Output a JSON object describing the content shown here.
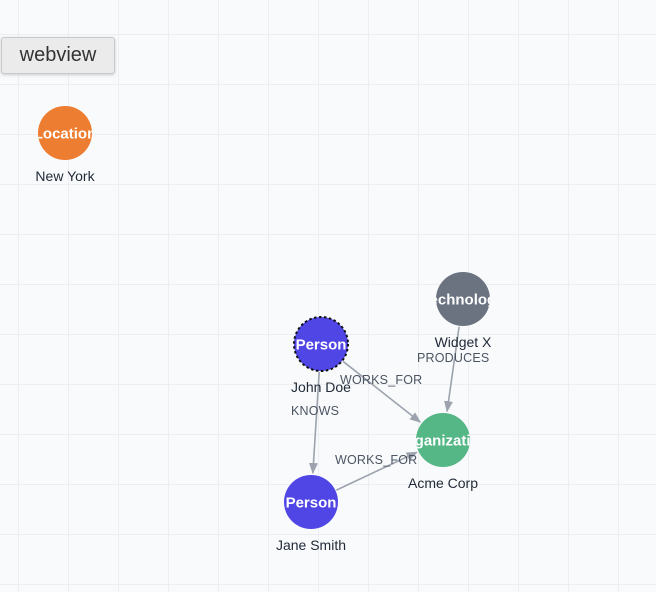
{
  "toolbar": {
    "webview_label": "webview"
  },
  "graph": {
    "nodes": [
      {
        "id": "new-york",
        "type": "Location",
        "name": "New York",
        "color": "#ed7d31"
      },
      {
        "id": "john-doe",
        "type": "Person",
        "name": "John Doe",
        "color": "#4f46e5",
        "selected": true
      },
      {
        "id": "jane-smith",
        "type": "Person",
        "name": "Jane Smith",
        "color": "#4f46e5"
      },
      {
        "id": "acme-corp",
        "type": "Organization",
        "name": "Acme Corp",
        "color": "#55b686"
      },
      {
        "id": "widget-x",
        "type": "Technology",
        "name": "Widget X",
        "color": "#6b7280"
      }
    ],
    "edges": [
      {
        "id": "e1",
        "source": "john-doe",
        "target": "jane-smith",
        "label": "KNOWS"
      },
      {
        "id": "e2",
        "source": "john-doe",
        "target": "acme-corp",
        "label": "WORKS_FOR"
      },
      {
        "id": "e3",
        "source": "jane-smith",
        "target": "acme-corp",
        "label": "WORKS_FOR"
      },
      {
        "id": "e4",
        "source": "widget-x",
        "target": "acme-corp",
        "label": "PRODUCES"
      }
    ],
    "edge_color": "#9ca3af"
  }
}
